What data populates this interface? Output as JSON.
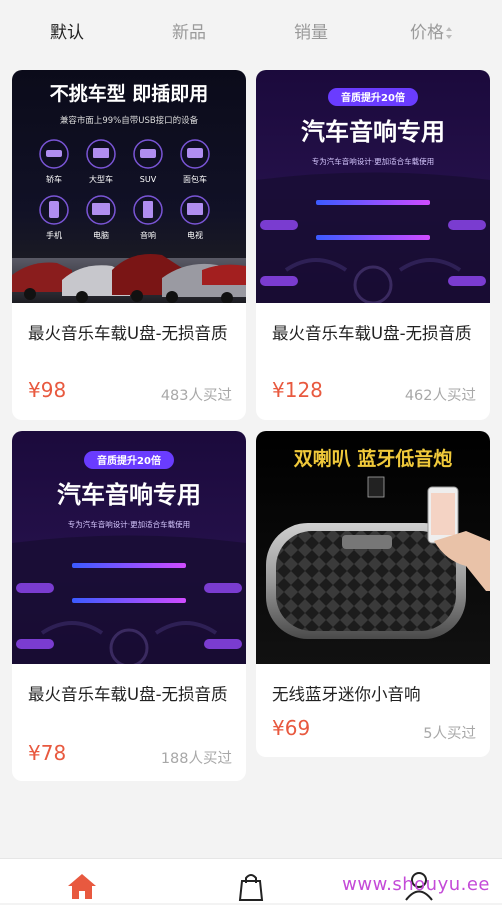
{
  "sort_bar": {
    "tabs": [
      {
        "label": "默认",
        "active": true
      },
      {
        "label": "新品",
        "active": false
      },
      {
        "label": "销量",
        "active": false
      },
      {
        "label": "价格",
        "active": false
      }
    ]
  },
  "products": [
    {
      "title": "最火音乐车载U盘-无损音质",
      "price": "¥98",
      "sold": "483人买过",
      "image": {
        "headline": "不挑车型  即插即用",
        "subline": "兼容市面上99%自带USB接口的设备",
        "icons": [
          "轿车",
          "大型车",
          "SUV",
          "面包车",
          "手机",
          "电脑",
          "音响",
          "电视"
        ]
      }
    },
    {
      "title": "最火音乐车载U盘-无损音质",
      "price": "¥128",
      "sold": "462人买过",
      "image": {
        "badge": "音质提升20倍",
        "headline": "汽车音响专用",
        "subline": "专为汽车音响设计·更加适合车载使用"
      }
    },
    {
      "title": "最火音乐车载U盘-无损音质",
      "price": "¥78",
      "sold": "188人买过",
      "image": {
        "badge": "音质提升20倍",
        "headline": "汽车音响专用",
        "subline": "专为汽车音响设计·更加适合车载使用"
      }
    },
    {
      "title": "无线蓝牙迷你小音响",
      "price": "¥69",
      "sold": "5人买过",
      "image": {
        "headline": "双喇叭 蓝牙低音炮"
      }
    }
  ],
  "tab_bar": {
    "items": [
      {
        "icon": "home-icon",
        "active": true
      },
      {
        "icon": "bag-icon",
        "active": false
      },
      {
        "icon": "user-icon",
        "active": false
      }
    ],
    "active_color": "#e8593f"
  },
  "watermark": "www.shouyu.ee",
  "colors": {
    "price": "#e8593f",
    "background": "#f3f3f3"
  }
}
